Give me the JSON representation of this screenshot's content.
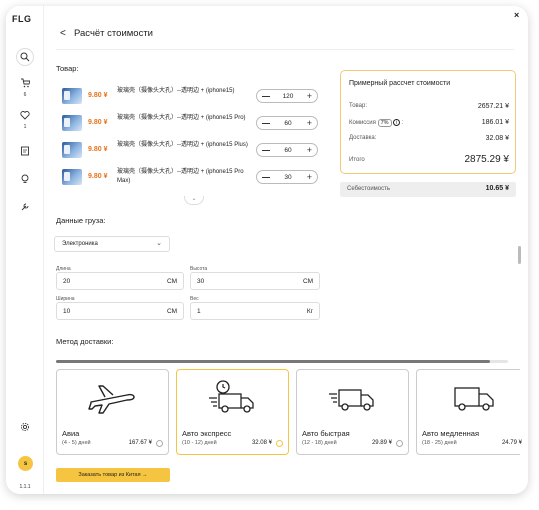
{
  "app": {
    "logo": "FLG",
    "version": "1.1.1",
    "avatar_letter": "s"
  },
  "sidebar": {
    "cart_count": "6",
    "favorites_count": "1"
  },
  "header": {
    "title": "Расчёт стоимости"
  },
  "products": {
    "label": "Товар:",
    "items": [
      {
        "price": "9.80 ¥",
        "name": "玻璃壳（摄像头大孔）--透明边 + (iphone15)",
        "qty": "120"
      },
      {
        "price": "9.80 ¥",
        "name": "玻璃壳（摄像头大孔）--透明边 + (iphone15 Pro)",
        "qty": "60"
      },
      {
        "price": "9.80 ¥",
        "name": "玻璃壳（摄像头大孔）--透明边 + (iphone15 Plus)",
        "qty": "60"
      },
      {
        "price": "9.80 ¥",
        "name": "玻璃壳（摄像头大孔）--透明边 + (iphone15 Pro Max)",
        "qty": "30"
      }
    ]
  },
  "summary": {
    "title": "Примерный рассчет стоимости",
    "goods_label": "Товар:",
    "goods_value": "2657.21 ¥",
    "commission_label": "Комиссия",
    "commission_rate": "7%",
    "commission_value": "186.01 ¥",
    "delivery_label": "Доставка:",
    "delivery_value": "32.08 ¥",
    "total_label": "Итого",
    "total_value": "2875.29 ¥",
    "cost_label": "Себестоимость",
    "cost_value": "10.65 ¥"
  },
  "cargo": {
    "label": "Данные груза:",
    "category": "Электроника",
    "length_label": "Длина",
    "length": "20",
    "length_unit": "СМ",
    "height_label": "Высота",
    "height": "30",
    "height_unit": "СМ",
    "width_label": "Ширина",
    "width": "10",
    "width_unit": "СМ",
    "weight_label": "Вес",
    "weight": "1",
    "weight_unit": "Кг"
  },
  "delivery": {
    "label": "Метод доставки:",
    "scroll_fraction": 0.96,
    "methods": [
      {
        "name": "Авиа",
        "days": "(4 - 5) дней",
        "price": "167.67 ¥",
        "icon": "airplane-icon"
      },
      {
        "name": "Авто экспресс",
        "days": "(10 - 12) дней",
        "price": "32.08 ¥",
        "icon": "express-truck-icon",
        "selected": true
      },
      {
        "name": "Авто быстрая",
        "days": "(12 - 18) дней",
        "price": "29.89 ¥",
        "icon": "fast-truck-icon"
      },
      {
        "name": "Авто медленная",
        "days": "(18 - 25) дней",
        "price": "24.79 ¥",
        "icon": "truck-icon"
      }
    ]
  },
  "actions": {
    "order_label": "Заказать товар из Китая →",
    "close": "×",
    "back": "<"
  },
  "colors": {
    "accent": "#f5c542",
    "price": "#e8731a"
  }
}
